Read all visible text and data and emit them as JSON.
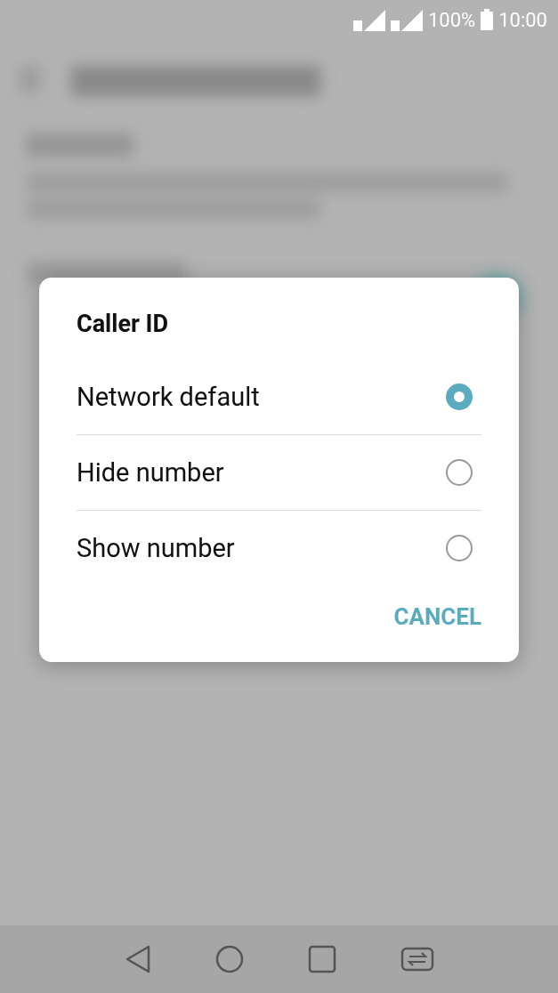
{
  "status_bar": {
    "battery": "100%",
    "time": "10:00"
  },
  "dialog": {
    "title": "Caller ID",
    "options": [
      {
        "label": "Network default",
        "selected": true
      },
      {
        "label": "Hide number",
        "selected": false
      },
      {
        "label": "Show number",
        "selected": false
      }
    ],
    "buttons": [
      "CANCEL"
    ]
  }
}
